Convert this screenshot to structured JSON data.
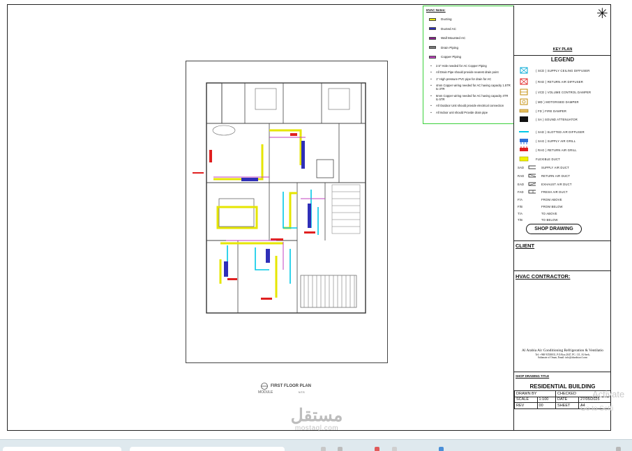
{
  "notes": {
    "title": "HVAC Notes:",
    "keys": [
      {
        "label": "Ducting",
        "color": "#e6e600"
      },
      {
        "label": "Ducted AC",
        "color": "#2f2fb8"
      },
      {
        "label": "Wall Mounted AC",
        "color": "#8a1f8a"
      },
      {
        "label": "Drain Piping",
        "color": "#7a7a7a"
      },
      {
        "label": "Copper Piping",
        "color": "#c040c0"
      }
    ],
    "items": [
      "2.5\" Hole needed for AC Copper Piping",
      "All Drain Pipe should provide nearest drain point",
      "1\" High pressure PVC pipe for drain for AC",
      "4mm Copper wiring needed for AC having capacity 1.5TR to 3TR",
      "6mm Copper wiring needed for AC having capacity 4TR to 5TR",
      "All Outdoor Unit should provide electrical connection",
      "All Indoor unit should Provide drain pipe"
    ]
  },
  "title_block": {
    "compass_glyph": "✳",
    "key_plan": "KEY PLAN",
    "legend_title": "LEGEND",
    "legend": [
      {
        "label": "( SCD ) SUPPLY CEILING DIFFUSER",
        "icon": "supply-ceiling-diffuser-icon"
      },
      {
        "label": "( RAD ) RETURN AIR DIFFUSER",
        "icon": "return-air-diffuser-icon"
      },
      {
        "label": "( VCD ) VOLUME CONTROL DAMPER",
        "icon": "volume-control-damper-icon"
      },
      {
        "label": "( MD ) MOTORISED DAMPER",
        "icon": "motorised-damper-icon"
      },
      {
        "label": "( FD ) FIRE DAMPER",
        "icon": "fire-damper-icon"
      },
      {
        "label": "( SA ) SOUND ATTENUATOR",
        "icon": "sound-attenuator-icon"
      },
      {
        "label": "( SAD ) SLOTTED AIR DIFFUSER",
        "icon": "slotted-air-diffuser-icon"
      },
      {
        "label": "( SAG ) SUPPLY AIR GRILL",
        "icon": "supply-air-grill-icon"
      },
      {
        "label": "( RAG ) RETURN AIR GRILL",
        "icon": "return-air-grill-icon"
      },
      {
        "label": "FLEXIBLE DUCT",
        "icon": "flexible-duct-icon"
      },
      {
        "code": "SAD",
        "label": "SUPPLY AIR DUCT",
        "icon": "supply-air-duct-icon"
      },
      {
        "code": "RAD",
        "label": "RETURN AIR DUCT",
        "icon": "return-air-duct-icon"
      },
      {
        "code": "EAD",
        "label": "EXHAUST AIR DUCT",
        "icon": "exhaust-air-duct-icon"
      },
      {
        "code": "FAD",
        "label": "FRESH AIR DUCT",
        "icon": "fresh-air-duct-icon"
      },
      {
        "code": "F/A",
        "label": "FROM ABOVE"
      },
      {
        "code": "F/B",
        "label": "FROM BELOW"
      },
      {
        "code": "T/A",
        "label": "TO ABOVE"
      },
      {
        "code": "T/B",
        "label": "TO BELOW"
      }
    ],
    "shop_drawing": "SHOP DRAWING",
    "client_label": "CLIENT",
    "contractor_label": "HVAC CONTRACTOR:",
    "contractor_name": "Al Arabia Air Conditioning Refrigeration & Ventilatio",
    "contractor_address": "Tel: +968 93538031, P.O.Box:2047, PC: 111, Al Seeb,",
    "contractor_contact": "Sultanate of Oman, Email: info@alarabiaccl.com",
    "sd_title_label": "SHOP DRAWING TITLE",
    "project": "RESIDENTIAL BUILDING",
    "drawn_by": "DRAWN BY",
    "checked": "CHECKED",
    "scale_label": "SCALE",
    "scale": "1:100",
    "date_label": "DATE",
    "date": "27/05/2025",
    "rev_label": "REV",
    "rev": "00",
    "sheet_label": "SHEET",
    "sheet": "A4"
  },
  "plan": {
    "caption": "FIRST FLOOR PLAN",
    "sub": "MODULE",
    "scale": "N.T.S"
  },
  "overlay": {
    "watermark": "مستقل",
    "watermark_sub": "mostaql.com",
    "activate_line1": "Activate",
    "activate_line2": "Go to Setti"
  },
  "colors": {
    "notes_border": "#3ad13a",
    "duct_yellow": "#e6e600",
    "cyan": "#00c8e6",
    "red": "#e02020",
    "magenta": "#c040c0",
    "blue": "#2f2fb8",
    "taskbar": "#dfe9ee"
  }
}
